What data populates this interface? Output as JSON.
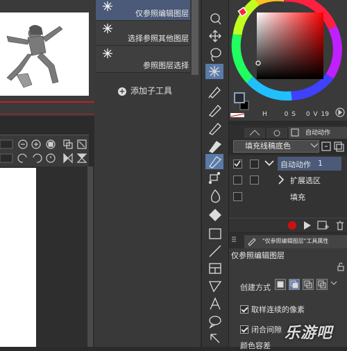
{
  "subtools": {
    "items": [
      {
        "label": "仅参照编辑图层",
        "selected": true
      },
      {
        "label": "选择参照其他图层",
        "selected": false
      },
      {
        "label": "参照图层选择",
        "selected": false
      }
    ],
    "add_label": "添加子工具"
  },
  "color": {
    "main": "#2a2a2a",
    "sub": "#000000",
    "readout": {
      "h_label": "H",
      "h_value": "0",
      "s_label": "S",
      "s_value": "0",
      "v_label": "V",
      "v_value": "19"
    }
  },
  "auto_action": {
    "tab_label": "自动动作",
    "set_name": "填充线稿底色",
    "actions": [
      {
        "label": "自动动作",
        "number": "1",
        "expanded": true,
        "checked": true
      },
      {
        "label": "扩展选区",
        "expanded": false,
        "checked": true
      },
      {
        "label": "填充",
        "checked": true
      }
    ]
  },
  "tool_property": {
    "title": "\"仅参照编辑图层\"工具属性",
    "subtool_name": "仅参照编辑图层",
    "create_mode_label": "创建方式",
    "options": [
      {
        "label": "取样连续的像素",
        "checked": true
      },
      {
        "label": "闭合间隙",
        "checked": true
      }
    ],
    "next_option": "颜色容差"
  },
  "watermark": "乐游吧"
}
